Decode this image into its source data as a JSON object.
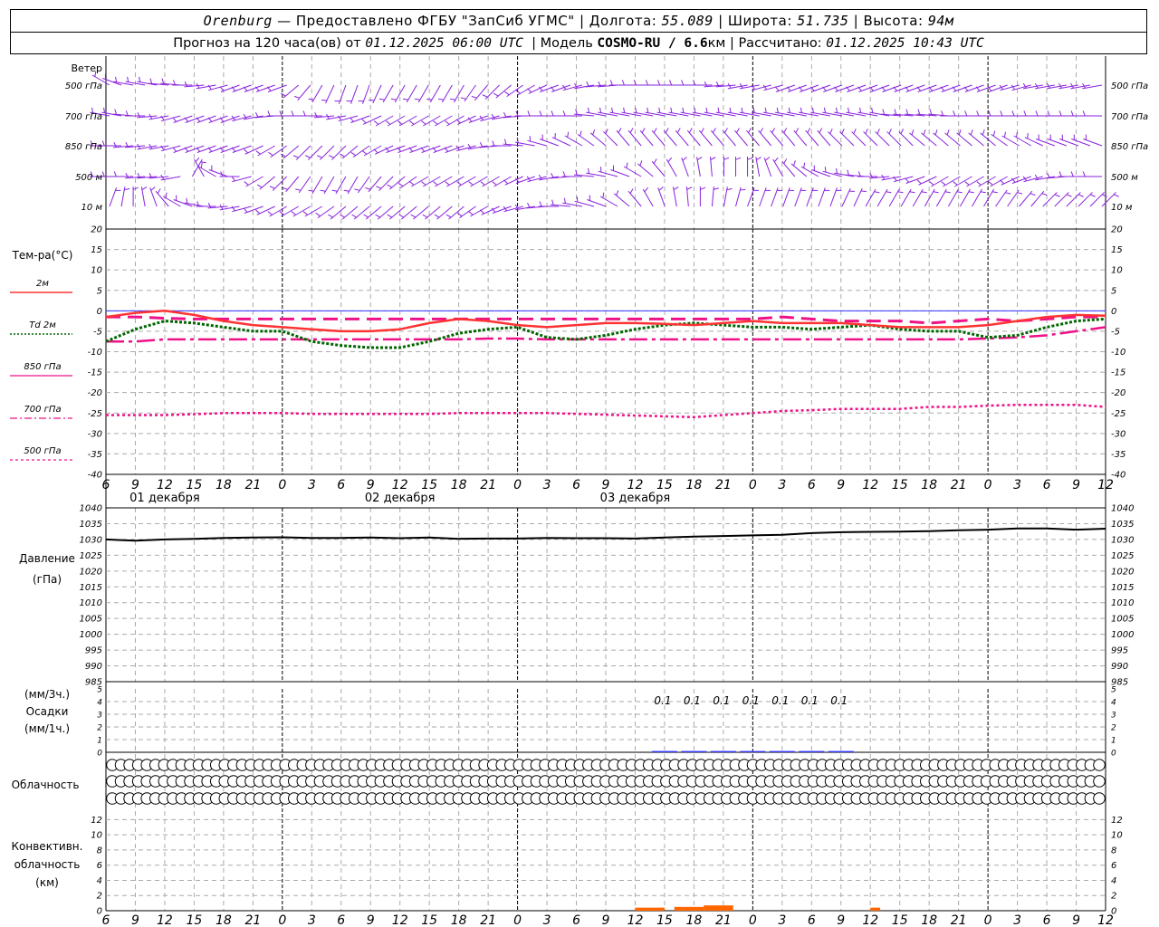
{
  "header": {
    "location": "Orenburg",
    "dash": "—",
    "provider": "Предоставлено ФГБУ \"ЗапСиб УГМС\"",
    "sep": "|",
    "lon_label": "Долгота:",
    "lon_value": "55.089",
    "lat_label": "Широта:",
    "lat_value": "51.735",
    "alt_label": "Высота:",
    "alt_value": "94м",
    "forecast_label": "Прогноз на 120 часа(ов)  от",
    "forecast_start": "01.12.2025 06:00 UTC",
    "model_label": "Модель",
    "model_name": "COSMO-RU / 6.6",
    "model_unit": "км",
    "calc_label": "Рассчитано:",
    "calc_time": "01.12.2025 10:43 UTC"
  },
  "labels": {
    "wind_title": "Ветер",
    "wind_levels": [
      "500 гПа",
      "700 гПа",
      "850 гПа",
      "500  м",
      "10  м"
    ],
    "temp_title": "Тем-ра(°С)",
    "temp_legend": [
      "2м",
      "Td  2м",
      "850 гПа",
      "700 гПа",
      "500 гПа"
    ],
    "pressure_title": "Давление",
    "pressure_unit": "(гПа)",
    "precip_lines": [
      "(мм/3ч.)",
      "Осадки",
      "(мм/1ч.)"
    ],
    "cloud_title": "Облачность",
    "conv_lines": [
      "Конвективн.",
      "облачность",
      "(км)"
    ]
  },
  "x_axis": {
    "hour_ticks": [
      "6",
      "9",
      "12",
      "15",
      "18",
      "21",
      "0",
      "3",
      "6",
      "9",
      "12",
      "15",
      "18",
      "21",
      "0",
      "3",
      "6",
      "9",
      "12",
      "15",
      "18",
      "21",
      "0",
      "3",
      "6",
      "9",
      "12",
      "15",
      "18",
      "21",
      "0",
      "3",
      "6",
      "9",
      "12"
    ],
    "date_labels": [
      "01 декабря",
      "02 декабря",
      "03 декабря"
    ]
  },
  "colors": {
    "t2m": "#ff3333",
    "td2m": "#006600",
    "t850": "#ee1188",
    "t700": "#ee1188",
    "t500": "#ee1188",
    "zero_line": "#3333ff",
    "wind": "#8822dd",
    "pressure": "#000000",
    "precip_bar": "#3333ff",
    "conv": "#ff6600",
    "grid": "#aaaaaa"
  },
  "chart_data": [
    {
      "type": "line",
      "title": "Тем-ра(°С)",
      "xlabel": "",
      "ylabel": "Тем-ра(°С)",
      "ylim": [
        -40,
        20
      ],
      "yticks": [
        20,
        15,
        10,
        5,
        0,
        -5,
        -10,
        -15,
        -20,
        -25,
        -30,
        -35,
        -40
      ],
      "x_hours": [
        0,
        3,
        6,
        9,
        12,
        15,
        18,
        21,
        24,
        27,
        30,
        33,
        36,
        39,
        42,
        45,
        48,
        51,
        54,
        57,
        60,
        63,
        66,
        69,
        72,
        75,
        78,
        81,
        84,
        87,
        90,
        93,
        96,
        99,
        102
      ],
      "series": [
        {
          "name": "2м",
          "style": "solid",
          "values": [
            -1.5,
            -0.5,
            0,
            -1,
            -2.5,
            -3.5,
            -4,
            -4.5,
            -5,
            -5,
            -4.5,
            -3,
            -2,
            -2.5,
            -3.5,
            -4,
            -3.5,
            -3,
            -3,
            -3.2,
            -3.5,
            -3,
            -2.5,
            -3,
            -3,
            -3,
            -3.5,
            -4,
            -4,
            -4,
            -3.5,
            -2.5,
            -1.5,
            -1,
            -1.2
          ]
        },
        {
          "name": "Td  2м",
          "style": "dotted",
          "values": [
            -7.5,
            -4.5,
            -2.5,
            -3,
            -4,
            -5,
            -5,
            -7.5,
            -8.5,
            -9,
            -9,
            -7.5,
            -5.5,
            -4.5,
            -4,
            -6.5,
            -7,
            -6,
            -4.5,
            -3.5,
            -3,
            -3.5,
            -4,
            -4,
            -4.5,
            -4,
            -3.5,
            -4.5,
            -5,
            -5,
            -6.5,
            -6,
            -4,
            -2.5,
            -2
          ]
        },
        {
          "name": "850 гПа",
          "style": "dashed",
          "values": [
            -1.5,
            -1.5,
            -1.8,
            -2,
            -2,
            -2,
            -2,
            -2,
            -2,
            -2,
            -2,
            -2,
            -2,
            -2,
            -2,
            -2,
            -2,
            -2,
            -2,
            -2,
            -2,
            -2,
            -2,
            -1.5,
            -2,
            -2.5,
            -2.5,
            -2.5,
            -3,
            -2.5,
            -2,
            -2.5,
            -2,
            -1.5,
            -1.5
          ]
        },
        {
          "name": "700 гПа",
          "style": "dashdot",
          "values": [
            -7.5,
            -7.5,
            -7,
            -7,
            -7,
            -7,
            -7,
            -7,
            -7,
            -7,
            -7,
            -7,
            -7,
            -6.8,
            -6.8,
            -7,
            -7,
            -7,
            -7,
            -7,
            -7,
            -7,
            -7,
            -7,
            -7,
            -7,
            -7,
            -7,
            -7,
            -7,
            -6.8,
            -6.5,
            -6,
            -5,
            -4
          ]
        },
        {
          "name": "500 гПа",
          "style": "dotted",
          "values": [
            -25.5,
            -25.5,
            -25.5,
            -25.3,
            -25,
            -25,
            -25,
            -25.2,
            -25.2,
            -25.2,
            -25.2,
            -25.2,
            -25,
            -25,
            -25,
            -25,
            -25.2,
            -25.4,
            -25.6,
            -25.8,
            -26,
            -25.5,
            -25,
            -24.5,
            -24.3,
            -24,
            -24,
            -24,
            -23.5,
            -23.5,
            -23.2,
            -23,
            -23,
            -23,
            -23.5
          ]
        }
      ]
    },
    {
      "type": "line",
      "title": "Давление",
      "xlabel": "",
      "ylabel": "Давление (гПа)",
      "ylim": [
        985,
        1040
      ],
      "yticks": [
        1040,
        1035,
        1030,
        1025,
        1020,
        1015,
        1010,
        1005,
        1000,
        995,
        990,
        985
      ],
      "x_hours": [
        0,
        3,
        6,
        9,
        12,
        15,
        18,
        21,
        24,
        27,
        30,
        33,
        36,
        39,
        42,
        45,
        48,
        51,
        54,
        57,
        60,
        63,
        66,
        69,
        72,
        75,
        78,
        81,
        84,
        87,
        90,
        93,
        96,
        99,
        102
      ],
      "series": [
        {
          "name": "Давление",
          "values": [
            1030,
            1029.6,
            1030,
            1030.2,
            1030.5,
            1030.6,
            1030.7,
            1030.5,
            1030.5,
            1030.6,
            1030.4,
            1030.6,
            1030.2,
            1030.3,
            1030.3,
            1030.5,
            1030.4,
            1030.4,
            1030.3,
            1030.6,
            1030.9,
            1031.1,
            1031.3,
            1031.5,
            1032,
            1032.3,
            1032.4,
            1032.5,
            1032.6,
            1032.9,
            1033.1,
            1033.5,
            1033.5,
            1033.1,
            1033.4
          ]
        }
      ]
    },
    {
      "type": "bar",
      "title": "Осадки",
      "xlabel": "",
      "ylabel": "Осадки (мм/3ч.)",
      "ylim": [
        0,
        5
      ],
      "yticks": [
        5,
        4,
        3,
        2,
        1,
        0
      ],
      "bar_hours": [
        57,
        60,
        63,
        66,
        69,
        72,
        75
      ],
      "bar_values": [
        0.1,
        0.1,
        0.1,
        0.1,
        0.1,
        0.1,
        0.1
      ],
      "bar_labels": [
        "0.1",
        "0.1",
        "0.1",
        "0.1",
        "0.1",
        "0.1",
        "0.1"
      ]
    },
    {
      "type": "bar",
      "title": "Конвективн. облачность",
      "xlabel": "",
      "ylabel": "(км)",
      "ylim": [
        0,
        13
      ],
      "yticks": [
        12,
        10,
        8,
        6,
        4,
        2,
        0
      ],
      "segments": [
        {
          "from_hour": 54,
          "to_hour": 57,
          "top_km": 0.4
        },
        {
          "from_hour": 58,
          "to_hour": 61,
          "top_km": 0.5
        },
        {
          "from_hour": 61,
          "to_hour": 64,
          "top_km": 0.7
        },
        {
          "from_hour": 78,
          "to_hour": 79,
          "top_km": 0.4
        }
      ]
    }
  ],
  "wind_rows": [
    {
      "level": "500 гПа",
      "dirs": [
        300,
        290,
        280,
        280,
        280,
        275,
        275,
        270,
        265,
        260,
        255,
        250,
        250,
        250,
        250,
        250,
        230,
        220,
        210,
        205,
        200,
        200,
        200,
        205,
        210,
        210,
        210,
        210,
        210,
        210,
        210,
        215,
        220,
        225,
        230,
        235,
        240,
        245,
        250,
        250,
        255,
        260,
        265,
        265,
        270,
        270,
        270,
        270,
        270,
        270,
        270,
        270,
        265,
        265,
        260,
        260,
        255,
        255,
        250,
        250,
        250,
        250,
        250,
        250,
        250,
        250,
        250,
        250,
        250,
        250,
        250,
        250,
        250,
        250,
        250,
        250,
        250,
        255,
        255,
        260,
        260,
        260,
        260,
        260,
        260
      ]
    },
    {
      "level": "700 гПа",
      "dirs": [
        280,
        280,
        275,
        270,
        265,
        260,
        255,
        250,
        250,
        250,
        250,
        250,
        255,
        260,
        265,
        270,
        270,
        270,
        270,
        265,
        260,
        255,
        250,
        245,
        240,
        240,
        240,
        240,
        240,
        240,
        240,
        245,
        250,
        255,
        260,
        265,
        270,
        270,
        270,
        270,
        270,
        275,
        280,
        280,
        280,
        280,
        280,
        280,
        280,
        280,
        280,
        280,
        280,
        280,
        280,
        280,
        280,
        280,
        280,
        280,
        280,
        280,
        280,
        280,
        280,
        280,
        280,
        275,
        275,
        275,
        275,
        275,
        270,
        270,
        270,
        270,
        270,
        270,
        270,
        270,
        270,
        270,
        270,
        270,
        270
      ]
    },
    {
      "level": "850 гПа",
      "dirs": [
        270,
        270,
        265,
        265,
        260,
        260,
        255,
        250,
        250,
        250,
        250,
        250,
        250,
        245,
        240,
        235,
        230,
        225,
        225,
        225,
        225,
        230,
        235,
        240,
        245,
        250,
        250,
        250,
        250,
        250,
        250,
        255,
        260,
        265,
        270,
        275,
        280,
        285,
        290,
        295,
        300,
        305,
        310,
        315,
        320,
        320,
        320,
        320,
        320,
        320,
        320,
        320,
        320,
        320,
        320,
        320,
        320,
        320,
        320,
        320,
        320,
        320,
        315,
        315,
        315,
        315,
        315,
        315,
        315,
        310,
        310,
        310,
        310,
        310,
        310,
        310,
        305,
        300,
        300,
        295,
        290,
        290,
        290,
        290,
        290
      ]
    },
    {
      "level": "500  м",
      "dirs": [
        270,
        270,
        270,
        265,
        265,
        265,
        260,
        30,
        330,
        300,
        290,
        270,
        255,
        240,
        230,
        225,
        220,
        215,
        210,
        210,
        210,
        210,
        215,
        220,
        225,
        230,
        235,
        240,
        240,
        240,
        240,
        240,
        240,
        240,
        240,
        245,
        250,
        255,
        260,
        265,
        270,
        275,
        280,
        285,
        290,
        300,
        310,
        320,
        330,
        340,
        350,
        355,
        0,
        0,
        0,
        350,
        340,
        330,
        320,
        310,
        300,
        290,
        285,
        280,
        275,
        270,
        265,
        260,
        255,
        250,
        245,
        240,
        240,
        240,
        240,
        240,
        240,
        245,
        250,
        255,
        260,
        265,
        270,
        270,
        270
      ]
    },
    {
      "level": "10  м",
      "dirs": [
        20,
        10,
        0,
        350,
        340,
        320,
        300,
        290,
        280,
        270,
        265,
        260,
        255,
        250,
        245,
        240,
        240,
        240,
        240,
        235,
        230,
        230,
        230,
        230,
        230,
        230,
        230,
        230,
        230,
        230,
        230,
        235,
        240,
        245,
        250,
        255,
        260,
        265,
        270,
        275,
        280,
        285,
        290,
        300,
        310,
        320,
        330,
        340,
        350,
        355,
        0,
        5,
        10,
        15,
        20,
        20,
        20,
        20,
        20,
        20,
        20,
        20,
        25,
        25,
        30,
        30,
        30,
        30,
        30,
        30,
        30,
        30,
        30,
        30,
        30,
        35,
        35,
        40,
        40,
        45,
        45,
        45,
        45,
        45,
        45
      ]
    }
  ],
  "cloud_rows": [
    {
      "name": "high",
      "cover": [
        0,
        0,
        0,
        0,
        0,
        0,
        0,
        0,
        0,
        0,
        0,
        0,
        0,
        0,
        0,
        0,
        0,
        0,
        0,
        0,
        0,
        0,
        0,
        0,
        0,
        0,
        0,
        0,
        0,
        0,
        0,
        0,
        0,
        0,
        0,
        0,
        0,
        0,
        0,
        0,
        0,
        0,
        0,
        0,
        0,
        0,
        0,
        0,
        0,
        0,
        0,
        0,
        0,
        0,
        0,
        0,
        0,
        0,
        0,
        0,
        0,
        0,
        0,
        0,
        0,
        0,
        0,
        0,
        0,
        0,
        0,
        0,
        0,
        0,
        0,
        0,
        0,
        0,
        0,
        0,
        0,
        0,
        0,
        0,
        0,
        0,
        0,
        0,
        0,
        0,
        0,
        0,
        0,
        0,
        0,
        0,
        0,
        0,
        0,
        0,
        0,
        0,
        0,
        0,
        0,
        0,
        0,
        0,
        0,
        0,
        0,
        0,
        0,
        0,
        0
      ]
    },
    {
      "name": "mid",
      "cover": [
        0,
        0,
        0,
        0,
        0,
        0,
        0,
        0,
        0,
        0,
        0,
        0,
        0,
        0,
        0,
        0,
        0,
        0,
        0,
        0,
        0,
        0,
        0,
        0,
        0,
        0,
        0,
        0,
        0,
        0,
        0,
        0,
        0,
        0,
        0,
        0,
        0,
        0,
        0,
        0,
        0,
        0,
        0,
        0,
        0,
        0,
        0,
        0,
        0,
        0,
        0,
        0,
        0,
        0,
        0,
        0,
        0,
        0,
        0,
        0,
        0,
        0,
        0,
        0,
        0,
        0,
        0,
        0,
        0,
        0,
        0,
        0,
        0,
        0,
        0,
        0,
        0,
        0,
        0,
        0,
        0,
        0,
        0,
        0,
        0,
        0,
        0,
        0,
        0,
        0,
        0,
        0,
        0,
        0,
        0,
        0,
        0,
        0,
        0,
        0,
        0,
        0,
        0,
        0,
        0,
        0,
        0,
        0,
        0,
        0,
        0,
        0,
        0,
        0,
        0
      ]
    },
    {
      "name": "low",
      "cover": [
        0,
        0,
        0,
        0,
        0,
        0,
        0,
        0,
        0,
        0,
        0,
        0,
        0,
        0,
        0,
        0,
        0,
        0,
        0,
        0,
        0,
        0,
        0,
        0,
        0,
        0,
        0,
        0,
        0,
        0,
        0,
        0,
        0,
        0,
        0,
        0,
        0,
        0,
        0,
        0,
        0,
        0,
        0,
        0,
        0,
        0,
        0,
        0,
        0,
        0,
        0,
        0,
        0,
        0,
        0,
        0,
        0,
        0,
        0,
        0,
        0,
        0,
        0,
        0,
        0,
        0,
        0,
        0,
        0,
        0,
        0,
        0,
        0,
        0,
        0,
        0,
        0,
        0,
        0,
        0,
        0,
        0,
        0,
        0,
        0,
        0,
        0,
        0,
        0,
        0,
        0,
        0,
        0,
        0,
        0,
        0,
        0,
        0,
        0,
        0,
        0,
        0,
        0,
        0,
        0,
        0,
        0,
        0,
        0,
        0,
        0,
        0,
        0,
        0,
        0
      ]
    }
  ]
}
